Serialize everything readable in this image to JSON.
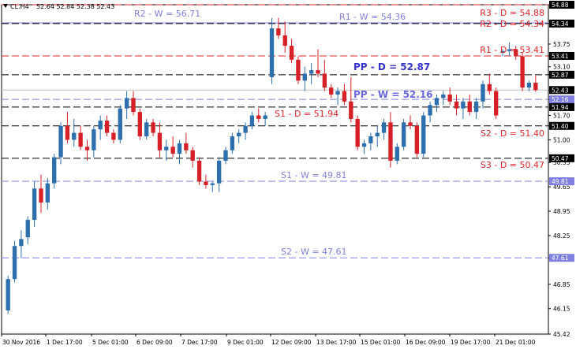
{
  "header": {
    "symbol": "CL.H4",
    "ohlc": "52.64 52.84 52.38 52.43"
  },
  "chart_data": {
    "type": "candlestick",
    "price_range": [
      45.42,
      54.88
    ],
    "price_ticks": [
      "54.88",
      "54.34",
      "53.75",
      "53.41",
      "53.10",
      "52.87",
      "52.43",
      "52.16",
      "51.70",
      "51.40",
      "51.00",
      "50.35",
      "49.65",
      "48.95",
      "48.25",
      "47.61",
      "46.85",
      "46.15",
      "45.42"
    ],
    "x_labels": [
      "30 Nov 2016",
      "1 Dec 17:00",
      "5 Dec 01:00",
      "6 Dec 09:00",
      "7 Dec 17:00",
      "9 Dec 01:00",
      "12 Dec 09:00",
      "13 Dec 17:00",
      "15 Dec 01:00",
      "16 Dec 09:00",
      "19 Dec 17:00",
      "21 Dec 01:00"
    ],
    "current_price": 52.43,
    "levels": [
      {
        "label": "R3 - D = 54.88",
        "value": 54.88,
        "group": "daily",
        "color": "#e2252a",
        "style": "dashed",
        "badge": "54.88",
        "badge_color": "#000000",
        "label_pos": "right"
      },
      {
        "label": "R2 - W = 56.71",
        "value": 56.71,
        "group": "weekly",
        "color": "#8080e0",
        "style": "none",
        "label_pos": "left"
      },
      {
        "label": "R1 - W = 54.36",
        "value": 54.36,
        "group": "weekly",
        "color": "#8080e0",
        "style": "solid",
        "label_pos": "mid"
      },
      {
        "label": "",
        "value": 54.34,
        "group": "daily",
        "color": "#000000",
        "style": "dashed",
        "badge": "54.34",
        "badge_color": "#000000"
      },
      {
        "label": "R2 - D = 54.34",
        "value": 54.2,
        "group": "daily",
        "color": "#e2252a",
        "style": "none",
        "label_pos": "right"
      },
      {
        "label": "R1 - D = 53.41",
        "value": 53.41,
        "group": "daily",
        "color": "#e2252a",
        "style": "dashed",
        "badge": "53.41",
        "badge_color": "#000000",
        "label_pos": "right"
      },
      {
        "label": "",
        "value": 52.87,
        "group": "daily",
        "color": "#000000",
        "style": "dashed",
        "badge": "52.87",
        "badge_color": "#000000"
      },
      {
        "label": "PP - D = 52.87",
        "value": 52.87,
        "group": "daily",
        "color": "#3333cc",
        "style": "none",
        "label_pos": "pp",
        "bold": true
      },
      {
        "label": "",
        "value": 52.43,
        "group": "price",
        "color": "#c0c0c0",
        "style": "solid",
        "badge": "52.43",
        "badge_color": "#000000"
      },
      {
        "label": "PP - W = 52.16",
        "value": 52.16,
        "group": "weekly",
        "color": "#8080e0",
        "style": "dashed",
        "badge": "52.16",
        "badge_color": "#8080e0",
        "label_pos": "pp",
        "bold": true
      },
      {
        "label": "S1 - D = 51.94",
        "value": 51.94,
        "group": "daily",
        "color": "#000000",
        "style": "dashed",
        "badge": "51.94",
        "badge_color": "#000000",
        "label_pos": "s1"
      },
      {
        "label": "S2 - D = 51.40",
        "value": 51.4,
        "group": "daily",
        "color": "#000000",
        "style": "dashed",
        "badge": "51.40",
        "badge_color": "#000000",
        "label_pos": "right"
      },
      {
        "label": "S3 - D = 50.47",
        "value": 50.47,
        "group": "daily",
        "color": "#000000",
        "style": "dashed",
        "badge": "50.47",
        "badge_color": "#000000",
        "label_pos": "right"
      },
      {
        "label": "S1 - W = 49.81",
        "value": 49.81,
        "group": "weekly",
        "color": "#8080e0",
        "style": "dashed",
        "badge": "49.81",
        "badge_color": "#8080e0",
        "label_pos": "mid"
      },
      {
        "label": "S2 - W = 47.61",
        "value": 47.61,
        "group": "weekly",
        "color": "#8080e0",
        "style": "dashed",
        "badge": "47.61",
        "badge_color": "#8080e0",
        "label_pos": "mid"
      }
    ],
    "candles": [
      [
        46.1,
        47.1,
        46.0,
        47.0
      ],
      [
        47.0,
        48.1,
        46.9,
        47.95
      ],
      [
        47.95,
        48.4,
        47.6,
        48.15
      ],
      [
        48.2,
        48.8,
        48.0,
        48.7
      ],
      [
        48.7,
        49.8,
        48.5,
        49.6
      ],
      [
        49.6,
        50.0,
        48.9,
        49.2
      ],
      [
        49.2,
        49.9,
        49.0,
        49.75
      ],
      [
        49.75,
        50.6,
        49.6,
        50.5
      ],
      [
        50.5,
        51.5,
        50.3,
        51.4
      ],
      [
        51.4,
        51.8,
        50.9,
        51.0
      ],
      [
        51.0,
        51.6,
        50.8,
        51.2
      ],
      [
        51.2,
        51.4,
        50.7,
        50.8
      ],
      [
        50.8,
        51.0,
        50.4,
        50.7
      ],
      [
        50.7,
        51.4,
        50.5,
        51.3
      ],
      [
        51.3,
        51.7,
        51.0,
        51.55
      ],
      [
        51.55,
        51.7,
        51.1,
        51.2
      ],
      [
        51.2,
        51.3,
        50.9,
        51.0
      ],
      [
        51.0,
        52.0,
        50.9,
        51.9
      ],
      [
        51.9,
        52.4,
        51.6,
        52.2
      ],
      [
        52.2,
        52.4,
        51.7,
        51.8
      ],
      [
        51.8,
        51.9,
        51.0,
        51.1
      ],
      [
        51.1,
        51.6,
        51.0,
        51.5
      ],
      [
        51.5,
        51.6,
        51.1,
        51.2
      ],
      [
        51.2,
        51.5,
        50.5,
        50.7
      ],
      [
        50.7,
        51.0,
        50.4,
        50.8
      ],
      [
        50.8,
        51.1,
        50.5,
        50.6
      ],
      [
        50.6,
        51.0,
        50.3,
        50.9
      ],
      [
        50.9,
        51.2,
        50.6,
        50.7
      ],
      [
        50.7,
        50.8,
        50.2,
        50.4
      ],
      [
        50.4,
        50.5,
        49.7,
        49.8
      ],
      [
        49.8,
        50.0,
        49.6,
        49.7
      ],
      [
        49.7,
        49.8,
        49.5,
        49.75
      ],
      [
        49.75,
        50.5,
        49.5,
        50.4
      ],
      [
        50.4,
        50.8,
        50.3,
        50.7
      ],
      [
        50.7,
        51.2,
        50.6,
        51.1
      ],
      [
        51.1,
        51.3,
        50.9,
        51.2
      ],
      [
        51.2,
        51.5,
        51.0,
        51.4
      ],
      [
        51.4,
        51.8,
        51.3,
        51.7
      ],
      [
        51.7,
        51.9,
        51.5,
        51.6
      ],
      [
        51.6,
        51.8,
        51.4,
        51.7
      ],
      [
        52.8,
        54.5,
        52.6,
        54.2
      ],
      [
        54.2,
        54.5,
        53.9,
        54.0
      ],
      [
        54.0,
        54.4,
        53.5,
        53.7
      ],
      [
        53.7,
        53.9,
        53.2,
        53.3
      ],
      [
        53.3,
        53.4,
        52.6,
        52.7
      ],
      [
        52.7,
        53.1,
        52.4,
        52.9
      ],
      [
        52.9,
        53.2,
        52.6,
        53.0
      ],
      [
        53.0,
        53.6,
        52.8,
        52.9
      ],
      [
        52.9,
        53.3,
        52.4,
        52.5
      ],
      [
        52.5,
        52.6,
        52.2,
        52.3
      ],
      [
        52.3,
        52.5,
        52.0,
        52.4
      ],
      [
        52.4,
        52.6,
        52.0,
        52.1
      ],
      [
        52.1,
        52.8,
        51.5,
        51.6
      ],
      [
        51.6,
        51.7,
        50.7,
        50.8
      ],
      [
        50.8,
        51.0,
        50.6,
        50.9
      ],
      [
        50.9,
        51.2,
        50.7,
        51.1
      ],
      [
        51.1,
        51.4,
        50.8,
        51.2
      ],
      [
        51.2,
        51.6,
        51.0,
        51.5
      ],
      [
        51.5,
        51.8,
        50.2,
        50.4
      ],
      [
        50.4,
        50.9,
        50.3,
        50.8
      ],
      [
        50.8,
        51.6,
        50.7,
        51.5
      ],
      [
        51.5,
        51.7,
        51.3,
        51.4
      ],
      [
        51.4,
        51.5,
        50.5,
        50.6
      ],
      [
        50.6,
        51.8,
        50.5,
        51.7
      ],
      [
        51.7,
        52.1,
        51.5,
        52.0
      ],
      [
        52.0,
        52.3,
        51.8,
        52.2
      ],
      [
        52.2,
        52.4,
        52.0,
        52.3
      ],
      [
        52.3,
        52.5,
        52.0,
        52.1
      ],
      [
        52.1,
        52.3,
        51.7,
        51.9
      ],
      [
        51.9,
        52.2,
        51.6,
        52.1
      ],
      [
        52.1,
        52.3,
        51.7,
        51.8
      ],
      [
        51.8,
        52.2,
        51.6,
        52.1
      ],
      [
        52.1,
        52.7,
        51.9,
        52.6
      ],
      [
        52.6,
        52.9,
        52.3,
        52.4
      ],
      [
        52.4,
        52.5,
        51.6,
        51.7
      ],
      [
        53.5,
        53.6,
        53.4,
        53.55
      ],
      [
        53.55,
        53.8,
        53.4,
        53.6
      ],
      [
        53.6,
        53.7,
        53.3,
        53.4
      ],
      [
        53.4,
        53.5,
        52.4,
        52.5
      ],
      [
        52.5,
        52.7,
        52.4,
        52.64
      ],
      [
        52.64,
        52.84,
        52.38,
        52.43
      ]
    ]
  }
}
